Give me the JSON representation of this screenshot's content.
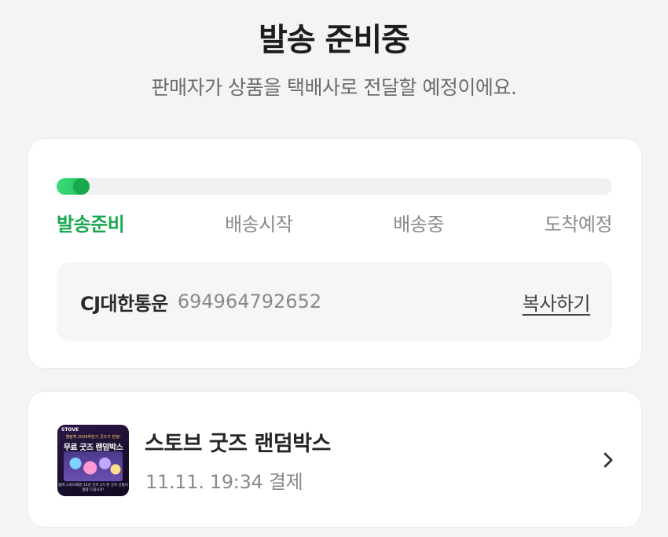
{
  "header": {
    "title": "발송 준비중",
    "subtitle": "판매자가 상품을 택배사로 전달할 예정이에요."
  },
  "shipping": {
    "progress": 0.06,
    "steps": [
      "발송준비",
      "배송시작",
      "배송중",
      "도착예정"
    ],
    "active_step": 0,
    "colors": {
      "active": "#1aa84f",
      "inactive": "#8a8a8a",
      "fill": "#16c15a"
    },
    "carrier": "CJ대한통운",
    "tracking_number": "694964792652",
    "copy_label": "복사하기"
  },
  "order": {
    "thumbnail": {
      "brand": "STOVE",
      "headline": "무료 굿즈 랜덤박스",
      "small_text": "웰컴백 2024하반기 굿즈가 한정!",
      "footer_text": "참여 스토브회원 15년 굿즈 1기 본 굿즈 선물이 팡팡 드립니다!"
    },
    "product_name": "스토브 굿즈 랜덤박스",
    "payment_info": "11.11. 19:34 결제",
    "detail_icon": "chevron-right-icon"
  }
}
